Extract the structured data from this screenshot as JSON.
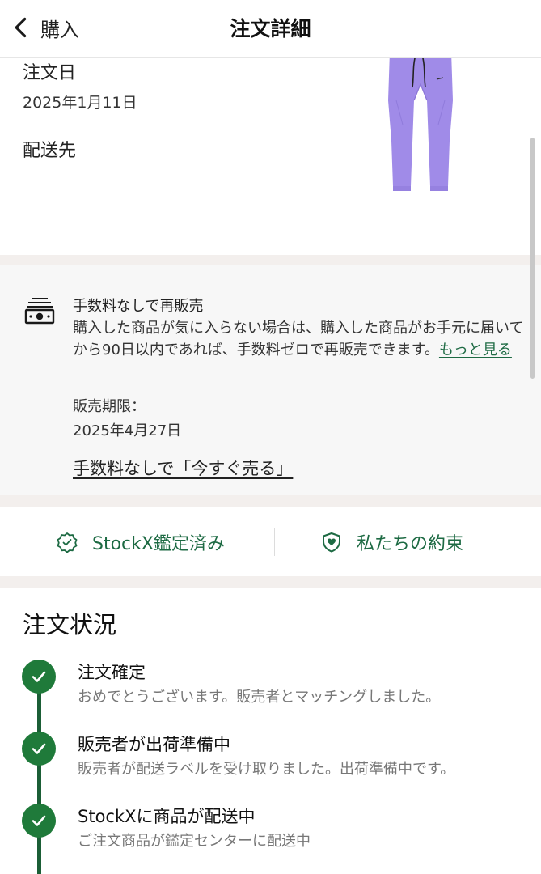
{
  "header": {
    "back_label": "購入",
    "title": "注文詳細"
  },
  "order": {
    "date_label": "注文日",
    "date_value": "2025年1月11日",
    "shipping_label": "配送先"
  },
  "resale": {
    "title": "手数料なしで再販売",
    "description": "購入した商品が気に入らない場合は、購入した商品がお手元に届いてから90日以内であれば、手数料ゼロで再販売できます。",
    "more_link": "もっと見る",
    "deadline_label": "販売期限：",
    "deadline_value": "2025年4月27日",
    "sell_now_link": "手数料なしで「今すぐ売る」"
  },
  "badges": {
    "verified_label": "StockX鑑定済み",
    "promise_label": "私たちの約束"
  },
  "status": {
    "title": "注文状況",
    "steps": [
      {
        "title": "注文確定",
        "description": "おめでとうございます。販売者とマッチングしました。"
      },
      {
        "title": "販売者が出荷準備中",
        "description": "販売者が配送ラベルを受け取りました。出荷準備中です。"
      },
      {
        "title": "StockXに商品が配送中",
        "description": "ご注文商品が鑑定センターに配送中"
      }
    ]
  },
  "colors": {
    "accent_green": "#1d6a43",
    "check_green": "#1f7a3a",
    "product_lavender": "#a08be8"
  }
}
